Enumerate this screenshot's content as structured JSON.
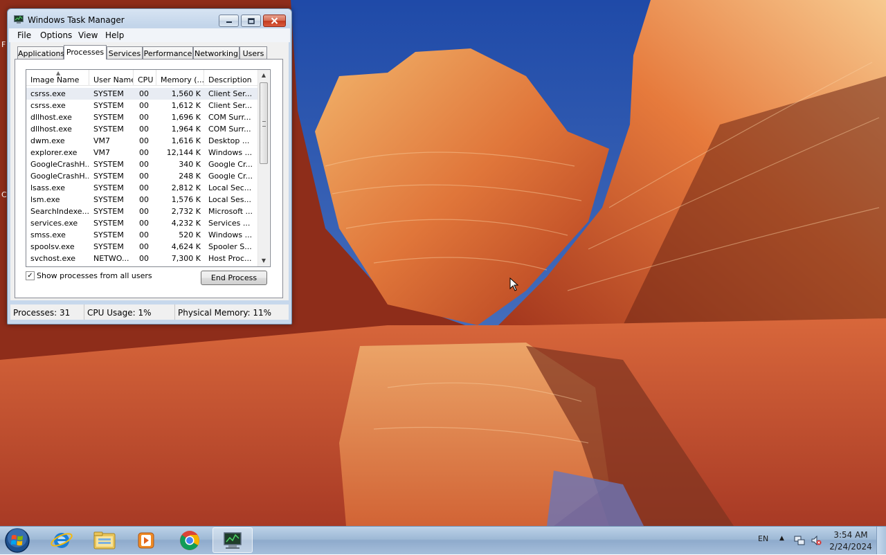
{
  "window": {
    "title": "Windows Task Manager",
    "icon": "task-manager-icon",
    "caption_buttons": [
      "minimize-icon",
      "maximize-icon",
      "close-icon"
    ]
  },
  "menu": [
    "File",
    "Options",
    "View",
    "Help"
  ],
  "tabs": [
    {
      "label": "Applications",
      "active": false
    },
    {
      "label": "Processes",
      "active": true
    },
    {
      "label": "Services",
      "active": false
    },
    {
      "label": "Performance",
      "active": false
    },
    {
      "label": "Networking",
      "active": false
    },
    {
      "label": "Users",
      "active": false
    }
  ],
  "processes": {
    "columns": [
      "Image Name",
      "User Name",
      "CPU",
      "Memory (...",
      "Description"
    ],
    "rows": [
      {
        "image": "csrss.exe",
        "user": "SYSTEM",
        "cpu": "00",
        "memory": "1,560 K",
        "description": "Client Ser..."
      },
      {
        "image": "csrss.exe",
        "user": "SYSTEM",
        "cpu": "00",
        "memory": "1,612 K",
        "description": "Client Ser..."
      },
      {
        "image": "dllhost.exe",
        "user": "SYSTEM",
        "cpu": "00",
        "memory": "1,696 K",
        "description": "COM Surr..."
      },
      {
        "image": "dllhost.exe",
        "user": "SYSTEM",
        "cpu": "00",
        "memory": "1,964 K",
        "description": "COM Surr..."
      },
      {
        "image": "dwm.exe",
        "user": "VM7",
        "cpu": "00",
        "memory": "1,616 K",
        "description": "Desktop ..."
      },
      {
        "image": "explorer.exe",
        "user": "VM7",
        "cpu": "00",
        "memory": "12,144 K",
        "description": "Windows ..."
      },
      {
        "image": "GoogleCrashH...",
        "user": "SYSTEM",
        "cpu": "00",
        "memory": "340 K",
        "description": "Google Cr..."
      },
      {
        "image": "GoogleCrashH...",
        "user": "SYSTEM",
        "cpu": "00",
        "memory": "248 K",
        "description": "Google Cr..."
      },
      {
        "image": "lsass.exe",
        "user": "SYSTEM",
        "cpu": "00",
        "memory": "2,812 K",
        "description": "Local Sec..."
      },
      {
        "image": "lsm.exe",
        "user": "SYSTEM",
        "cpu": "00",
        "memory": "1,576 K",
        "description": "Local Ses..."
      },
      {
        "image": "SearchIndexe...",
        "user": "SYSTEM",
        "cpu": "00",
        "memory": "2,732 K",
        "description": "Microsoft ..."
      },
      {
        "image": "services.exe",
        "user": "SYSTEM",
        "cpu": "00",
        "memory": "4,232 K",
        "description": "Services ..."
      },
      {
        "image": "smss.exe",
        "user": "SYSTEM",
        "cpu": "00",
        "memory": "520 K",
        "description": "Windows ..."
      },
      {
        "image": "spoolsv.exe",
        "user": "SYSTEM",
        "cpu": "00",
        "memory": "4,624 K",
        "description": "Spooler S..."
      },
      {
        "image": "svchost.exe",
        "user": "NETWO...",
        "cpu": "00",
        "memory": "7,300 K",
        "description": "Host Proc..."
      }
    ],
    "selected_row": 0
  },
  "show_all_users": {
    "label": "Show processes from all users",
    "checked": true,
    "check_glyph": "✓"
  },
  "end_process_label": "End Process",
  "status": {
    "processes": "Processes: 31",
    "cpu": "CPU Usage: 1%",
    "memory": "Physical Memory: 11%"
  },
  "taskbar": {
    "pinned": [
      "windows-start-orb-icon",
      "internet-explorer-icon",
      "windows-explorer-icon",
      "media-player-icon",
      "chrome-icon",
      "task-manager-icon"
    ],
    "language": "EN",
    "tray_arrow": "▲",
    "time": "3:54 AM",
    "date": "2/24/2024"
  },
  "desktop_edge_glyphs": [
    "F",
    "C"
  ],
  "colors": {
    "sky": "#2b59b8",
    "rock": "#d9582a",
    "taskbar": "#a6bfdb"
  }
}
